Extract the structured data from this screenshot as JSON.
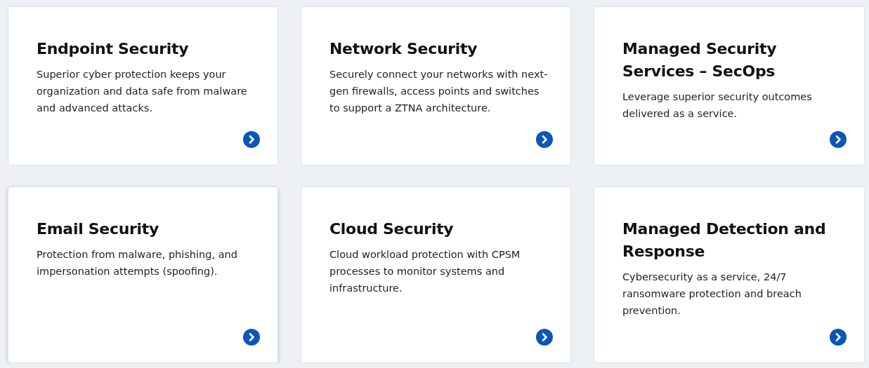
{
  "cards": [
    {
      "title": "Endpoint Security",
      "description": "Superior cyber protection keeps your organization and data safe from malware and advanced attacks.",
      "hovered": false
    },
    {
      "title": "Network Security",
      "description": "Securely connect your networks with next-gen firewalls, access points and switches to support a ZTNA architecture.",
      "hovered": false
    },
    {
      "title": "Managed Security Services – SecOps",
      "description": "Leverage superior security outcomes delivered as a service.",
      "hovered": false
    },
    {
      "title": "Email Security",
      "description": "Protection from malware, phishing, and impersonation attempts (spoofing).",
      "hovered": true
    },
    {
      "title": "Cloud Security",
      "description": "Cloud workload protection with CPSM processes to monitor systems and infrastructure.",
      "hovered": false
    },
    {
      "title": "Managed Detection and Response",
      "description": "Cybersecurity as a service, 24/7 ransomware protection and breach prevention.",
      "hovered": false
    }
  ]
}
